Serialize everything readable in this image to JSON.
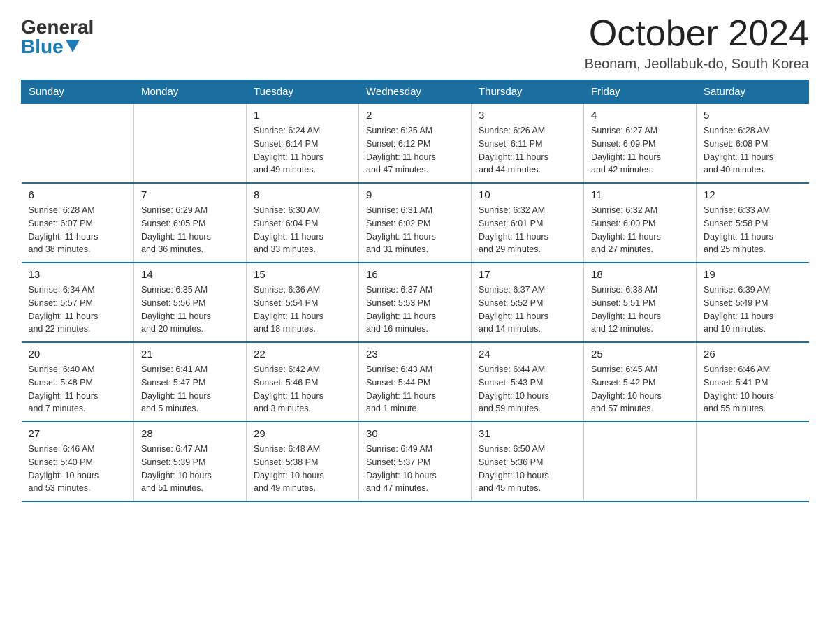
{
  "logo": {
    "general": "General",
    "blue": "Blue"
  },
  "title": {
    "month": "October 2024",
    "location": "Beonam, Jeollabuk-do, South Korea"
  },
  "weekdays": [
    "Sunday",
    "Monday",
    "Tuesday",
    "Wednesday",
    "Thursday",
    "Friday",
    "Saturday"
  ],
  "weeks": [
    [
      {
        "day": "",
        "info": ""
      },
      {
        "day": "",
        "info": ""
      },
      {
        "day": "1",
        "info": "Sunrise: 6:24 AM\nSunset: 6:14 PM\nDaylight: 11 hours\nand 49 minutes."
      },
      {
        "day": "2",
        "info": "Sunrise: 6:25 AM\nSunset: 6:12 PM\nDaylight: 11 hours\nand 47 minutes."
      },
      {
        "day": "3",
        "info": "Sunrise: 6:26 AM\nSunset: 6:11 PM\nDaylight: 11 hours\nand 44 minutes."
      },
      {
        "day": "4",
        "info": "Sunrise: 6:27 AM\nSunset: 6:09 PM\nDaylight: 11 hours\nand 42 minutes."
      },
      {
        "day": "5",
        "info": "Sunrise: 6:28 AM\nSunset: 6:08 PM\nDaylight: 11 hours\nand 40 minutes."
      }
    ],
    [
      {
        "day": "6",
        "info": "Sunrise: 6:28 AM\nSunset: 6:07 PM\nDaylight: 11 hours\nand 38 minutes."
      },
      {
        "day": "7",
        "info": "Sunrise: 6:29 AM\nSunset: 6:05 PM\nDaylight: 11 hours\nand 36 minutes."
      },
      {
        "day": "8",
        "info": "Sunrise: 6:30 AM\nSunset: 6:04 PM\nDaylight: 11 hours\nand 33 minutes."
      },
      {
        "day": "9",
        "info": "Sunrise: 6:31 AM\nSunset: 6:02 PM\nDaylight: 11 hours\nand 31 minutes."
      },
      {
        "day": "10",
        "info": "Sunrise: 6:32 AM\nSunset: 6:01 PM\nDaylight: 11 hours\nand 29 minutes."
      },
      {
        "day": "11",
        "info": "Sunrise: 6:32 AM\nSunset: 6:00 PM\nDaylight: 11 hours\nand 27 minutes."
      },
      {
        "day": "12",
        "info": "Sunrise: 6:33 AM\nSunset: 5:58 PM\nDaylight: 11 hours\nand 25 minutes."
      }
    ],
    [
      {
        "day": "13",
        "info": "Sunrise: 6:34 AM\nSunset: 5:57 PM\nDaylight: 11 hours\nand 22 minutes."
      },
      {
        "day": "14",
        "info": "Sunrise: 6:35 AM\nSunset: 5:56 PM\nDaylight: 11 hours\nand 20 minutes."
      },
      {
        "day": "15",
        "info": "Sunrise: 6:36 AM\nSunset: 5:54 PM\nDaylight: 11 hours\nand 18 minutes."
      },
      {
        "day": "16",
        "info": "Sunrise: 6:37 AM\nSunset: 5:53 PM\nDaylight: 11 hours\nand 16 minutes."
      },
      {
        "day": "17",
        "info": "Sunrise: 6:37 AM\nSunset: 5:52 PM\nDaylight: 11 hours\nand 14 minutes."
      },
      {
        "day": "18",
        "info": "Sunrise: 6:38 AM\nSunset: 5:51 PM\nDaylight: 11 hours\nand 12 minutes."
      },
      {
        "day": "19",
        "info": "Sunrise: 6:39 AM\nSunset: 5:49 PM\nDaylight: 11 hours\nand 10 minutes."
      }
    ],
    [
      {
        "day": "20",
        "info": "Sunrise: 6:40 AM\nSunset: 5:48 PM\nDaylight: 11 hours\nand 7 minutes."
      },
      {
        "day": "21",
        "info": "Sunrise: 6:41 AM\nSunset: 5:47 PM\nDaylight: 11 hours\nand 5 minutes."
      },
      {
        "day": "22",
        "info": "Sunrise: 6:42 AM\nSunset: 5:46 PM\nDaylight: 11 hours\nand 3 minutes."
      },
      {
        "day": "23",
        "info": "Sunrise: 6:43 AM\nSunset: 5:44 PM\nDaylight: 11 hours\nand 1 minute."
      },
      {
        "day": "24",
        "info": "Sunrise: 6:44 AM\nSunset: 5:43 PM\nDaylight: 10 hours\nand 59 minutes."
      },
      {
        "day": "25",
        "info": "Sunrise: 6:45 AM\nSunset: 5:42 PM\nDaylight: 10 hours\nand 57 minutes."
      },
      {
        "day": "26",
        "info": "Sunrise: 6:46 AM\nSunset: 5:41 PM\nDaylight: 10 hours\nand 55 minutes."
      }
    ],
    [
      {
        "day": "27",
        "info": "Sunrise: 6:46 AM\nSunset: 5:40 PM\nDaylight: 10 hours\nand 53 minutes."
      },
      {
        "day": "28",
        "info": "Sunrise: 6:47 AM\nSunset: 5:39 PM\nDaylight: 10 hours\nand 51 minutes."
      },
      {
        "day": "29",
        "info": "Sunrise: 6:48 AM\nSunset: 5:38 PM\nDaylight: 10 hours\nand 49 minutes."
      },
      {
        "day": "30",
        "info": "Sunrise: 6:49 AM\nSunset: 5:37 PM\nDaylight: 10 hours\nand 47 minutes."
      },
      {
        "day": "31",
        "info": "Sunrise: 6:50 AM\nSunset: 5:36 PM\nDaylight: 10 hours\nand 45 minutes."
      },
      {
        "day": "",
        "info": ""
      },
      {
        "day": "",
        "info": ""
      }
    ]
  ]
}
